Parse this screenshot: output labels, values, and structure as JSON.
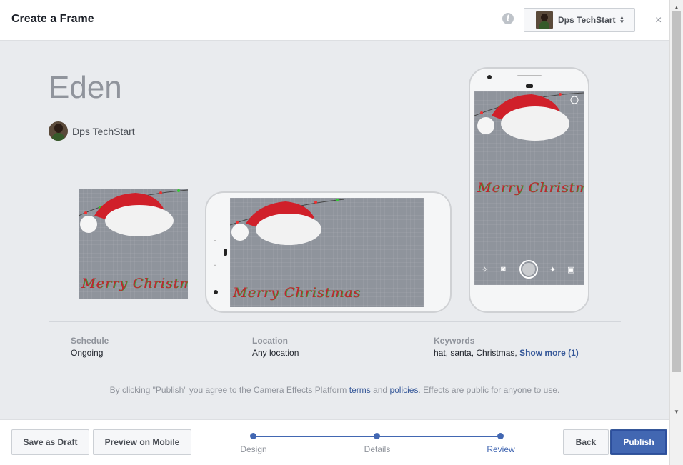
{
  "header": {
    "title": "Create a Frame",
    "account_name": "Dps TechStart",
    "close_label": "×"
  },
  "effect": {
    "name": "Eden",
    "owner": "Dps TechStart",
    "overlay_text": "Merry Christmas"
  },
  "details": {
    "schedule_label": "Schedule",
    "schedule_value": "Ongoing",
    "location_label": "Location",
    "location_value": "Any location",
    "keywords_label": "Keywords",
    "keywords_value": "hat, santa, Christmas,",
    "show_more": "Show more (1)"
  },
  "legal": {
    "prefix": "By clicking \"Publish\" you agree to the Camera Effects Platform ",
    "terms": "terms",
    "and": " and ",
    "policies": "policies",
    "suffix": ". Effects are public for anyone to use."
  },
  "footer": {
    "save_draft": "Save as Draft",
    "preview_mobile": "Preview on Mobile",
    "back": "Back",
    "publish": "Publish",
    "steps": [
      {
        "label": "Design"
      },
      {
        "label": "Details"
      },
      {
        "label": "Review"
      }
    ],
    "active_step": "Review"
  },
  "colors": {
    "accent": "#4267b2",
    "link": "#365899",
    "frame_bg": "#8f949c",
    "hat_red": "#d0202a"
  }
}
